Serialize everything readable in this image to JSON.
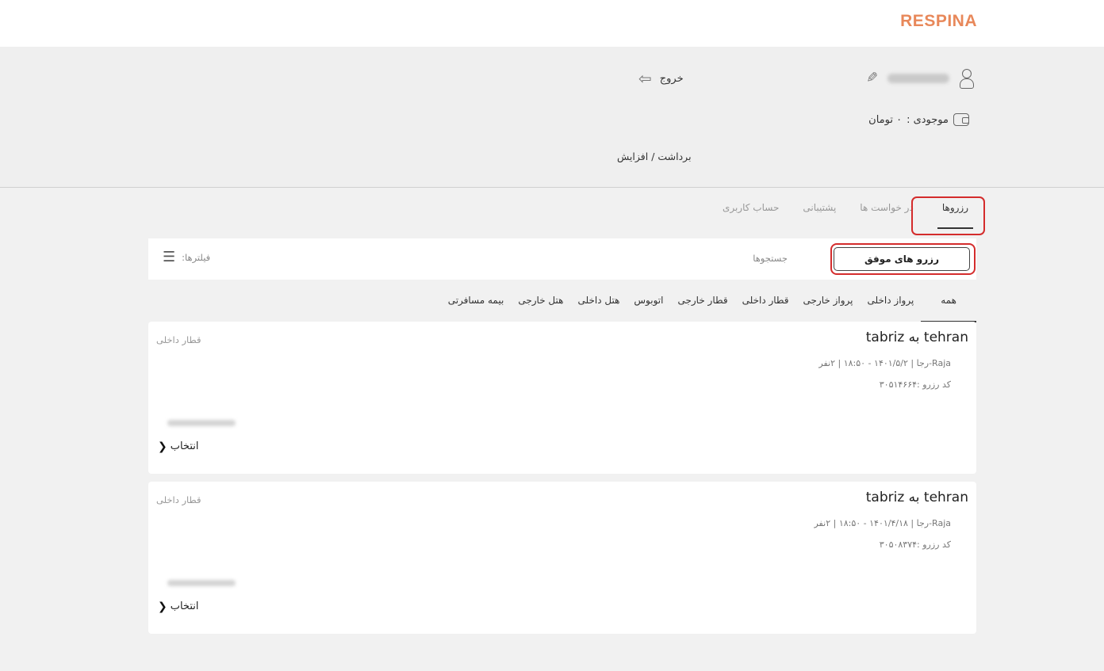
{
  "header": {
    "logo": "RESPINA"
  },
  "account": {
    "logout_label": "خروج",
    "balance_label": "موجودی :",
    "balance_value": "۰ تومان",
    "withdraw_label": "برداشت / افزایش"
  },
  "main_tabs": [
    {
      "label": "رزروها",
      "active": true
    },
    {
      "label": "در خواست ها",
      "active": false
    },
    {
      "label": "پشتیبانی",
      "active": false
    },
    {
      "label": "حساب کاربری",
      "active": false
    }
  ],
  "segment": {
    "successful_label": "رزرو های موفق",
    "searches_label": "جستجوها",
    "filters_label": "فیلترها:"
  },
  "category_tabs": [
    {
      "label": "همه",
      "active": true
    },
    {
      "label": "پرواز داخلی"
    },
    {
      "label": "پرواز خارجی"
    },
    {
      "label": "قطار داخلی"
    },
    {
      "label": "قطار خارجی"
    },
    {
      "label": "اتوبوس"
    },
    {
      "label": "هتل داخلی"
    },
    {
      "label": "هتل خارجی"
    },
    {
      "label": "بیمه مسافرتی"
    }
  ],
  "reservations": [
    {
      "route": "tehran به tabriz",
      "detail": "Raja-رجا | ۱۴۰۱/۵/۲ - ۱۸:۵۰ | ۲نفر",
      "code": "کد رزرو :۳۰۵۱۴۶۶۴",
      "type": "قطار داخلی",
      "select_label": "انتخاب"
    },
    {
      "route": "tehran به tabriz",
      "detail": "Raja-رجا | ۱۴۰۱/۴/۱۸ - ۱۸:۵۰ | ۲نفر",
      "code": "کد رزرو :۳۰۵۰۸۳۷۴",
      "type": "قطار داخلی",
      "select_label": "انتخاب"
    }
  ],
  "colors": {
    "brand": "#e8885a",
    "highlight": "#d42c2c"
  }
}
